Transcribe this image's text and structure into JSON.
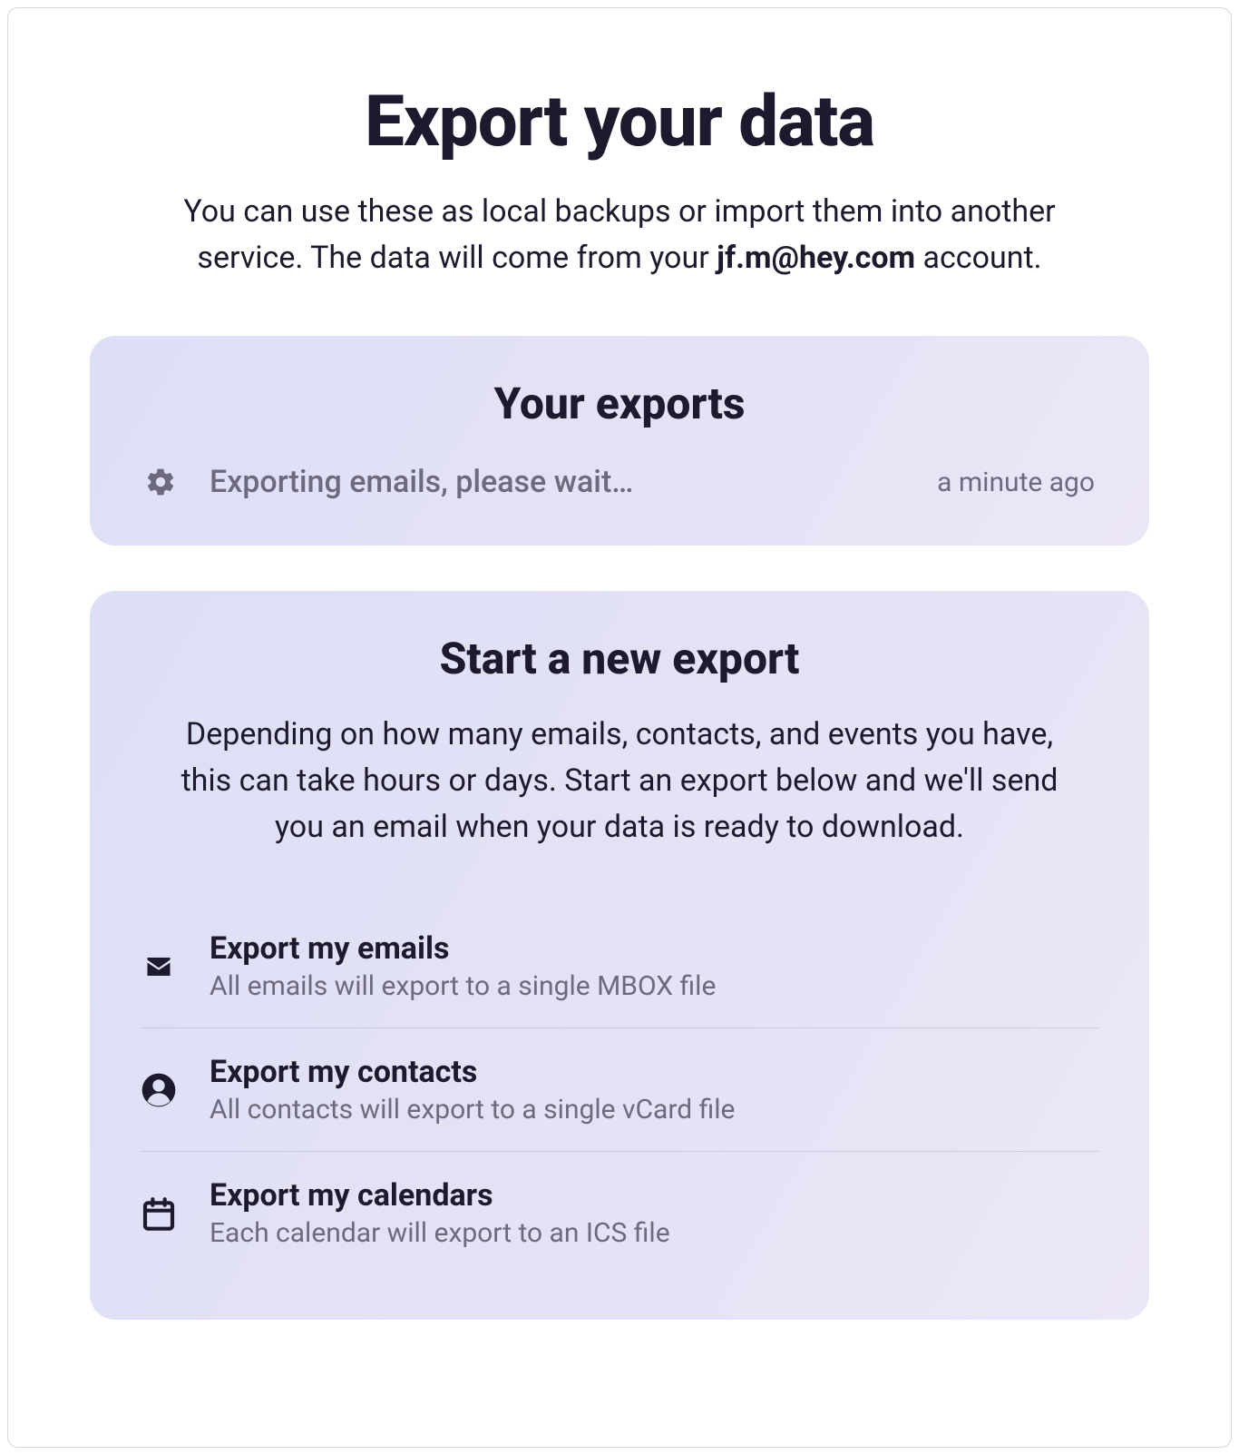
{
  "header": {
    "title": "Export your data",
    "subtitle_pre": "You can use these as local backups or import them into another service. The data will come from your ",
    "subtitle_account": "jf.m@hey.com",
    "subtitle_post": " account."
  },
  "your_exports": {
    "title": "Your exports",
    "status": {
      "text": "Exporting emails, please wait…",
      "time": "a minute ago"
    }
  },
  "new_export": {
    "title": "Start a new export",
    "subtitle": "Depending on how many emails, contacts, and events you have, this can take hours or days. Start an export below and we'll send you an email when your data is ready to download.",
    "options": [
      {
        "label": "Export my emails",
        "desc": "All emails will export to a single MBOX file"
      },
      {
        "label": "Export my contacts",
        "desc": "All contacts will export to a single vCard file"
      },
      {
        "label": "Export my calendars",
        "desc": "Each calendar will export to an ICS file"
      }
    ]
  }
}
